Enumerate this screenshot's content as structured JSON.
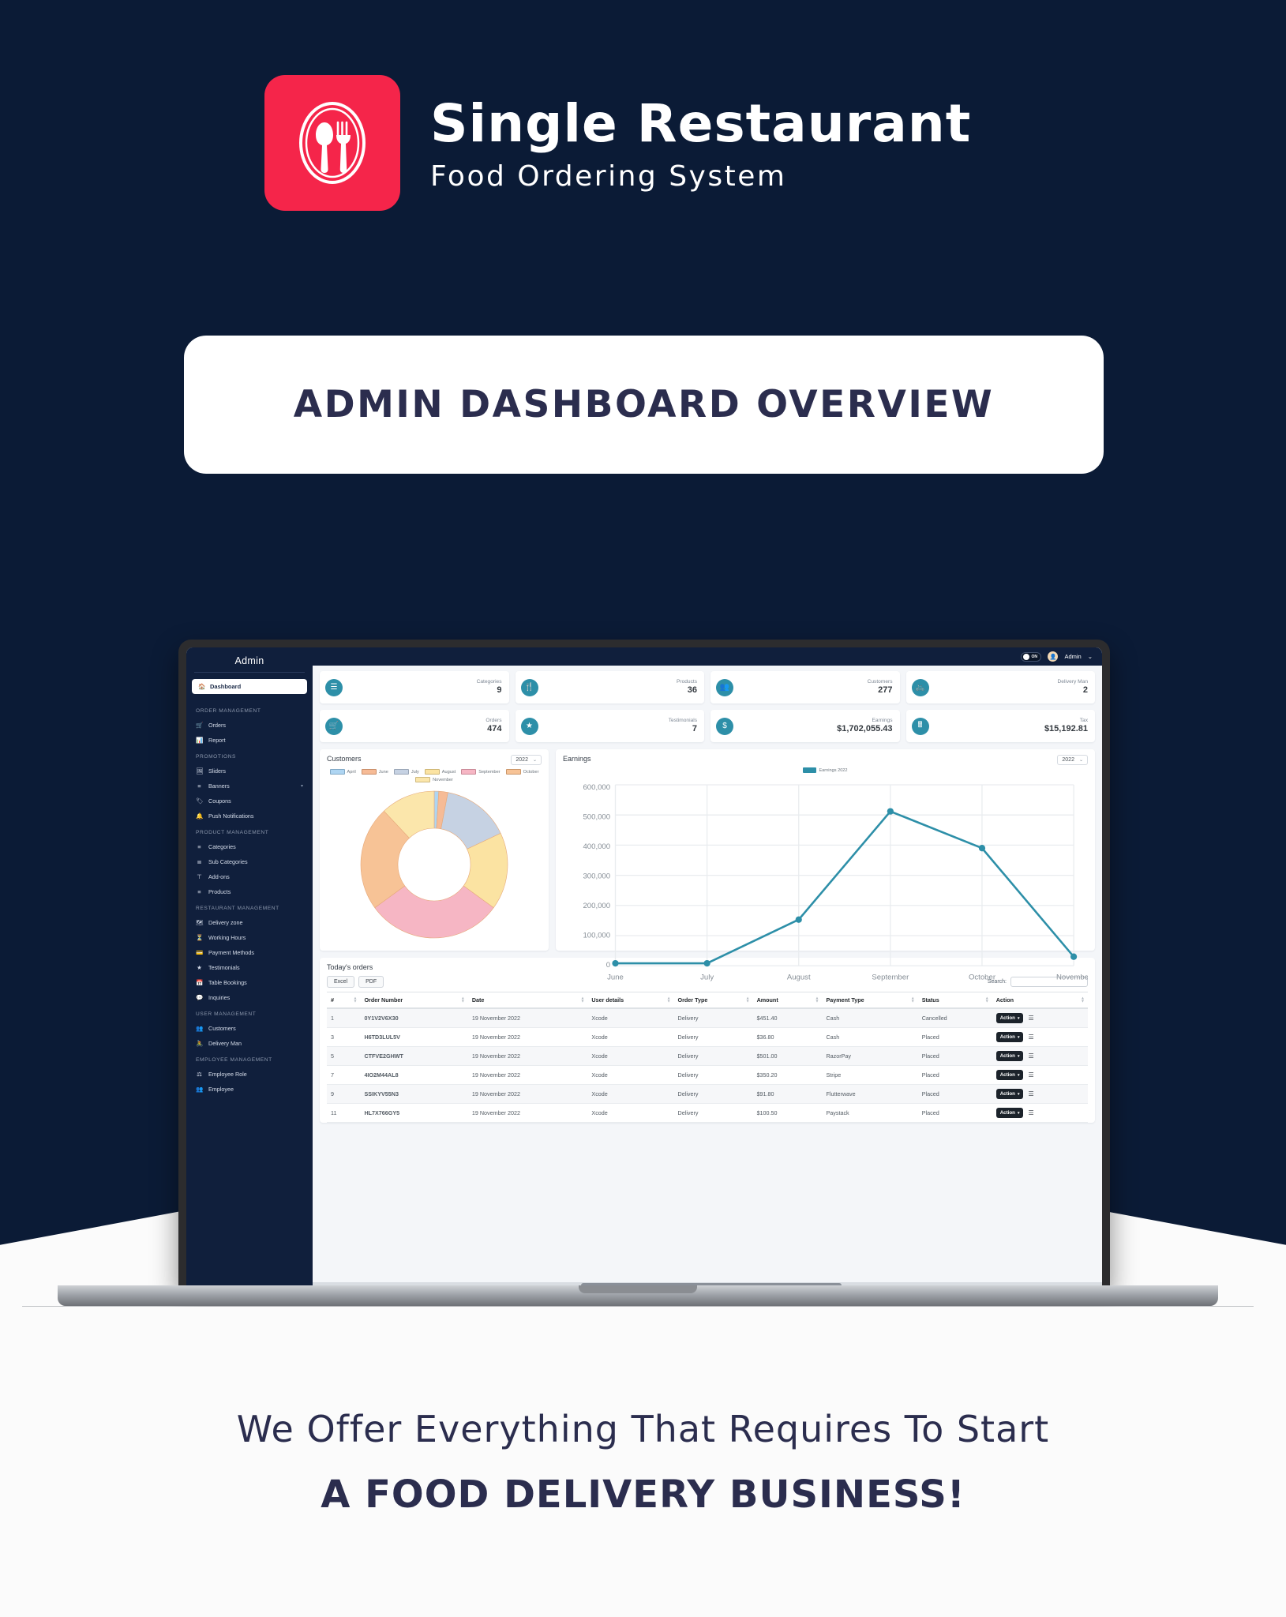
{
  "brand": {
    "title": "Single Restaurant",
    "subtitle": "Food Ordering System",
    "logo_icon": "plate-spoon-fork-icon",
    "logo_color": "#f5254a"
  },
  "banner": {
    "text": "ADMIN DASHBOARD OVERVIEW"
  },
  "footer": {
    "line1": "We Offer Everything That Requires To Start",
    "line2": "A FOOD DELIVERY BUSINESS!"
  },
  "dashboard": {
    "sidebar": {
      "title": "Admin",
      "active": {
        "label": "Dashboard",
        "icon": "home-icon"
      },
      "groups": [
        {
          "label": "ORDER MANAGEMENT",
          "items": [
            {
              "label": "Orders",
              "icon": "cart-icon"
            },
            {
              "label": "Report",
              "icon": "chart-icon"
            }
          ]
        },
        {
          "label": "PROMOTIONS",
          "items": [
            {
              "label": "Sliders",
              "icon": "image-icon"
            },
            {
              "label": "Banners",
              "icon": "banner-icon",
              "caret": "▾"
            },
            {
              "label": "Coupons",
              "icon": "tag-icon"
            },
            {
              "label": "Push Notifications",
              "icon": "bell-icon"
            }
          ]
        },
        {
          "label": "PRODUCT MANAGEMENT",
          "items": [
            {
              "label": "Categories",
              "icon": "list-icon"
            },
            {
              "label": "Sub Categories",
              "icon": "sublist-icon"
            },
            {
              "label": "Add-ons",
              "icon": "plus-bar-icon"
            },
            {
              "label": "Products",
              "icon": "products-icon"
            }
          ]
        },
        {
          "label": "RESTAURANT MANAGEMENT",
          "items": [
            {
              "label": "Delivery zone",
              "icon": "map-icon"
            },
            {
              "label": "Working Hours",
              "icon": "clock-icon"
            },
            {
              "label": "Payment Methods",
              "icon": "card-icon"
            },
            {
              "label": "Testimonials",
              "icon": "star-icon"
            },
            {
              "label": "Table Bookings",
              "icon": "calendar-icon"
            },
            {
              "label": "Inquiries",
              "icon": "chat-icon"
            }
          ]
        },
        {
          "label": "USER MANAGEMENT",
          "items": [
            {
              "label": "Customers",
              "icon": "users-icon"
            },
            {
              "label": "Delivery Man",
              "icon": "bike-icon"
            }
          ]
        },
        {
          "label": "EMPLOYEE MANAGEMENT",
          "items": [
            {
              "label": "Employee Role",
              "icon": "role-icon"
            },
            {
              "label": "Employee",
              "icon": "users-icon"
            }
          ]
        }
      ]
    },
    "topbar": {
      "toggle_label": "ON",
      "user_name": "Admin",
      "user_caret": "⌄",
      "avatar_icon": "avatar-icon"
    },
    "stats": [
      {
        "label": "Categories",
        "value": "9",
        "icon": "list-icon"
      },
      {
        "label": "Products",
        "value": "36",
        "icon": "cutlery-icon"
      },
      {
        "label": "Customers",
        "value": "277",
        "icon": "users-icon"
      },
      {
        "label": "Delivery Man",
        "value": "2",
        "icon": "bike-icon"
      },
      {
        "label": "Orders",
        "value": "474",
        "icon": "cart-icon"
      },
      {
        "label": "Testimonials",
        "value": "7",
        "icon": "star-icon"
      },
      {
        "label": "Earnings",
        "value": "$1,702,055.43",
        "icon": "dollar-icon"
      },
      {
        "label": "Tax",
        "value": "$15,192.81",
        "icon": "calculator-icon"
      }
    ],
    "customers_card": {
      "title": "Customers",
      "year": "2022",
      "caret": "⌄"
    },
    "earnings_card": {
      "title": "Earnings",
      "year": "2022",
      "caret": "⌄"
    },
    "orders_table": {
      "title": "Today's orders",
      "excel_label": "Excel",
      "pdf_label": "PDF",
      "search_label": "Search:",
      "search_value": "",
      "search_placeholder": "",
      "columns": [
        "#",
        "Order Number",
        "Date",
        "User details",
        "Order Type",
        "Amount",
        "Payment Type",
        "Status",
        "Action"
      ],
      "action_label": "Action",
      "action_caret": "▾",
      "rows": [
        {
          "num": "1",
          "order": "0Y1V2V6X30",
          "date": "19 November 2022",
          "user": "Xcode",
          "type": "Delivery",
          "amount": "$451.40",
          "payment": "Cash",
          "status": "Cancelled"
        },
        {
          "num": "3",
          "order": "H6TD3LUL5V",
          "date": "19 November 2022",
          "user": "Xcode",
          "type": "Delivery",
          "amount": "$36.80",
          "payment": "Cash",
          "status": "Placed"
        },
        {
          "num": "5",
          "order": "CTFVE2GHWT",
          "date": "19 November 2022",
          "user": "Xcode",
          "type": "Delivery",
          "amount": "$501.00",
          "payment": "RazorPay",
          "status": "Placed"
        },
        {
          "num": "7",
          "order": "4IO2M44AL8",
          "date": "19 November 2022",
          "user": "Xcode",
          "type": "Delivery",
          "amount": "$350.20",
          "payment": "Stripe",
          "status": "Placed"
        },
        {
          "num": "9",
          "order": "SSIKYV55N3",
          "date": "19 November 2022",
          "user": "Xcode",
          "type": "Delivery",
          "amount": "$91.80",
          "payment": "Flutterwave",
          "status": "Placed"
        },
        {
          "num": "11",
          "order": "HL7X766GY5",
          "date": "19 November 2022",
          "user": "Xcode",
          "type": "Delivery",
          "amount": "$100.50",
          "payment": "Paystack",
          "status": "Placed"
        }
      ]
    }
  },
  "chart_data": [
    {
      "type": "pie",
      "title": "Customers",
      "subtitle": "2022",
      "legend_position": "top",
      "categories": [
        "April",
        "June",
        "July",
        "August",
        "September",
        "October",
        "November"
      ],
      "values": [
        1,
        2,
        15,
        17,
        30,
        23,
        12
      ],
      "colors": [
        "#aed5f2",
        "#f6bb96",
        "#c6d2e3",
        "#fbe3a2",
        "#f6b6c4",
        "#f7c396",
        "#fbe6ab"
      ],
      "xlabel": "",
      "ylabel": ""
    },
    {
      "type": "line",
      "title": "Earnings",
      "subtitle": "2022",
      "legend": [
        "Earnings 2022"
      ],
      "legend_position": "top-right",
      "color": "#2d8fa8",
      "categories": [
        "June",
        "July",
        "August",
        "September",
        "October",
        "November"
      ],
      "values": [
        8000,
        8000,
        153000,
        512000,
        390000,
        30000
      ],
      "yticks": [
        "0",
        "100,000",
        "200,000",
        "300,000",
        "400,000",
        "500,000",
        "600,000"
      ],
      "ylim": [
        0,
        600000
      ],
      "grid": true,
      "xlabel": "",
      "ylabel": ""
    }
  ]
}
